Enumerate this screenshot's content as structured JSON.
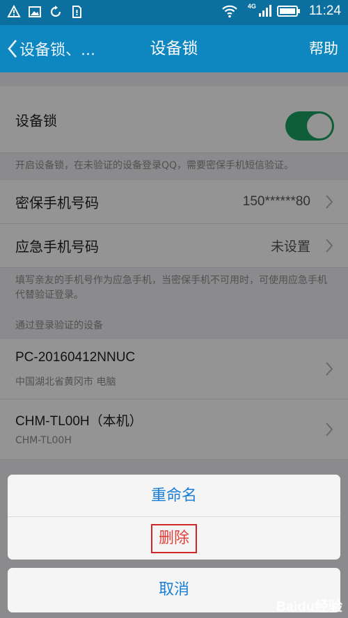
{
  "status_bar": {
    "time": "11:24",
    "network": "4G",
    "icons": [
      "warning-icon",
      "image-icon",
      "sync-icon",
      "sim-icon",
      "wifi-icon",
      "signal-icon",
      "battery-icon"
    ]
  },
  "nav": {
    "back_label": "设备锁、...",
    "title": "设备锁",
    "help_label": "帮助"
  },
  "device_lock": {
    "label": "设备锁",
    "enabled": true,
    "note": "开启设备锁，在未验证的设备登录QQ，需要密保手机短信验证。"
  },
  "phones": {
    "secure_label": "密保手机号码",
    "secure_value": "150******80",
    "emergency_label": "应急手机号码",
    "emergency_value": "未设置",
    "note": "填写亲友的手机号作为应急手机，当密保手机不可用时，可使用应急手机代替验证登录。"
  },
  "devices": {
    "section_title": "通过登录验证的设备",
    "items": [
      {
        "name": "PC-20160412NNUC",
        "detail": "中国湖北省黄冈市 电脑"
      },
      {
        "name": "CHM-TL00H（本机）",
        "detail": "CHM-TL00H"
      }
    ]
  },
  "action_sheet": {
    "rename_label": "重命名",
    "delete_label": "删除",
    "cancel_label": "取消"
  },
  "watermark": "Baidu经验",
  "colors": {
    "status_bar": "#0b6fa0",
    "nav_bar": "#0e86bf",
    "toggle_on": "#1aa262",
    "action_blue": "#1a7fd4",
    "delete_red": "#e0403a",
    "highlight_box": "#d4262a"
  }
}
